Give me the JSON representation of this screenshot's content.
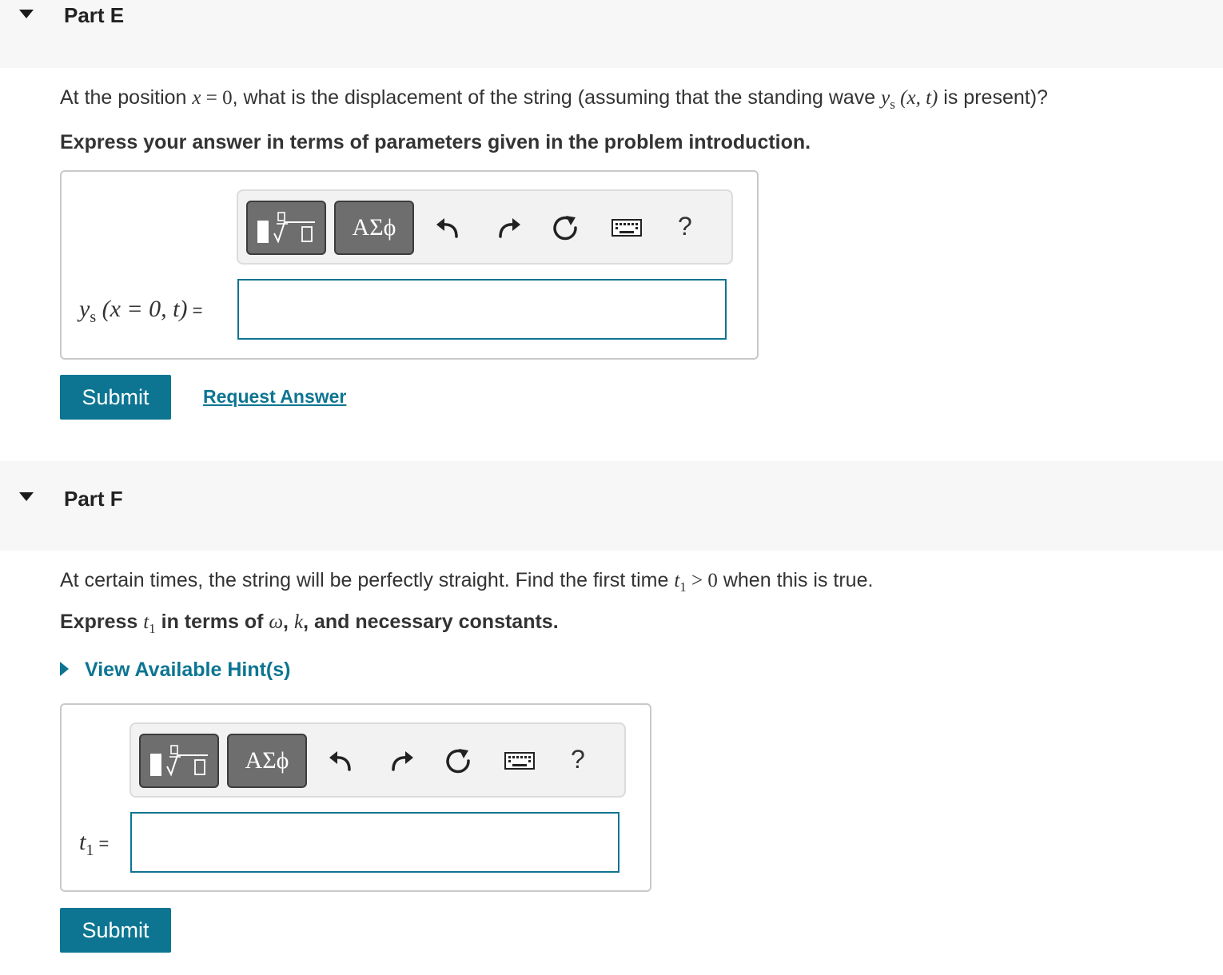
{
  "part_e": {
    "title": "Part E",
    "question": {
      "prefix": "At the position ",
      "x_var": "x",
      "eq_zero": " = 0",
      "middle": ", what is the displacement of the string (assuming that the standing wave ",
      "wave_y": "y",
      "wave_sub": "s",
      "wave_args": " (x, t)",
      "suffix": " is present)?"
    },
    "instruction": "Express your answer in terms of parameters given in the problem introduction.",
    "toolbar": {
      "templates_icon": "fraction-radical-templates-icon",
      "greek_label": "ΑΣϕ",
      "undo_icon": "undo-icon",
      "redo_icon": "redo-icon",
      "reset_icon": "reset-icon",
      "keyboard_icon": "keyboard-icon",
      "help_label": "?"
    },
    "equation": {
      "y": "y",
      "sub": "s",
      "args": " (x = 0, t)",
      "equals": " ="
    },
    "answer_value": "",
    "submit_label": "Submit",
    "request_label": "Request Answer"
  },
  "part_f": {
    "title": "Part F",
    "question": {
      "prefix": "At certain times, the string will be perfectly straight. Find the first time ",
      "t": "t",
      "sub": "1",
      "rel": " > 0",
      "suffix": " when this is true."
    },
    "instruction": {
      "prefix": "Express ",
      "t": "t",
      "sub": "1",
      "middle": " in terms of ",
      "omega": "ω",
      "comma1": ", ",
      "k": "k",
      "suffix": ", and necessary constants."
    },
    "hint_label": "View Available Hint(s)",
    "toolbar": {
      "templates_icon": "fraction-radical-templates-icon",
      "greek_label": "ΑΣϕ",
      "undo_icon": "undo-icon",
      "redo_icon": "redo-icon",
      "reset_icon": "reset-icon",
      "keyboard_icon": "keyboard-icon",
      "help_label": "?"
    },
    "equation": {
      "t": "t",
      "sub": "1",
      "equals": " ="
    },
    "answer_value": "",
    "submit_label": "Submit"
  },
  "colors": {
    "accent": "#0d7592",
    "header_bg": "#f7f7f7",
    "toolbar_btn": "#6e6e6e"
  }
}
